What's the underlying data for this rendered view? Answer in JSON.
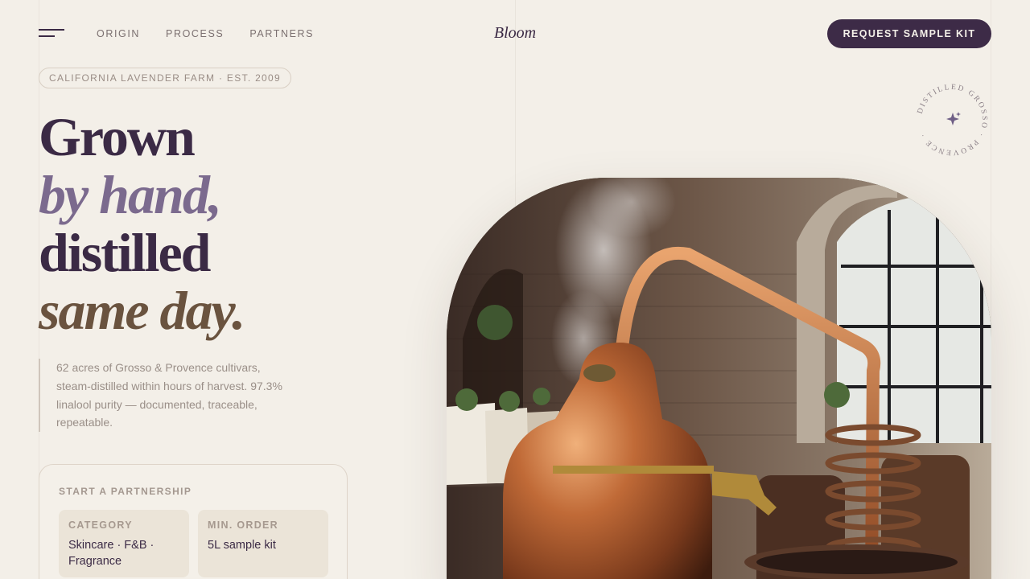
{
  "header": {
    "menu_icon": "menu-icon",
    "nav": [
      "ORIGIN",
      "PROCESS",
      "PARTNERS"
    ],
    "brand": "Bloom",
    "cta": "REQUEST SAMPLE KIT"
  },
  "eyebrow": "CALIFORNIA LAVENDER FARM · EST. 2009",
  "headline": {
    "line1": "Grown",
    "line2": "by hand,",
    "line3": "distilled",
    "line4": "same day."
  },
  "description": "62 acres of Grosso & Provence cultivars, steam-distilled within hours of harvest. 97.3% linalool purity — documented, traceable, repeatable.",
  "badge": {
    "circular_text": "DISTILLED GROSSO · PROVENCE ·",
    "icon": "sparkle-icon"
  },
  "partnership": {
    "title": "START A PARTNERSHIP",
    "fields": [
      {
        "label": "CATEGORY",
        "value": "Skincare · F&B · Fragrance"
      },
      {
        "label": "MIN. ORDER",
        "value": "5L sample kit"
      }
    ]
  },
  "hero": {
    "subject": "copper-still-photo"
  },
  "colors": {
    "background": "#f3efe8",
    "primary": "#3d2b47",
    "accent_lavender": "#7b6a8e",
    "accent_brown": "#6a533f"
  }
}
